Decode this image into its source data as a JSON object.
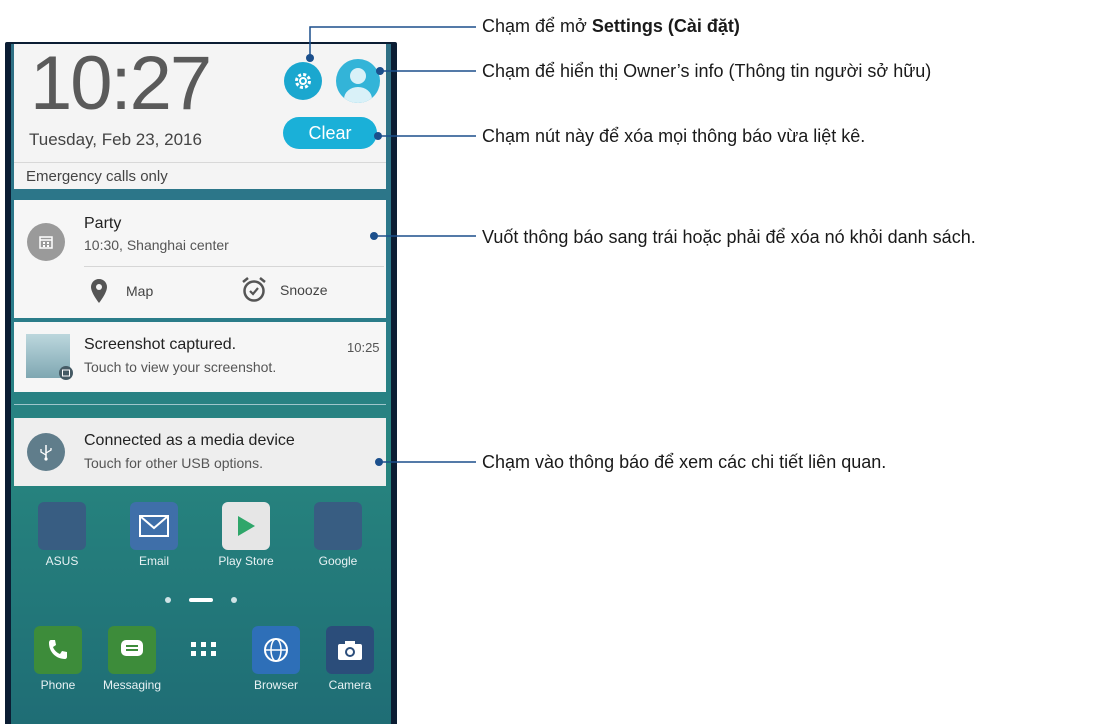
{
  "lockscreen": {
    "time": "10:27",
    "date": "Tuesday, Feb 23, 2016",
    "clear_label": "Clear",
    "emergency_text": "Emergency calls only"
  },
  "notifications": {
    "party": {
      "title": "Party",
      "subtitle": "10:30, Shanghai center",
      "action_map": "Map",
      "action_snooze": "Snooze"
    },
    "screenshot": {
      "title": "Screenshot captured.",
      "subtitle": "Touch to view your screenshot.",
      "time": "10:25"
    },
    "usb": {
      "title": "Connected as a media device",
      "subtitle": "Touch for other USB options."
    }
  },
  "home": {
    "row1": [
      "ASUS",
      "Email",
      "Play Store",
      "Google"
    ],
    "dock": [
      "Phone",
      "Messaging",
      "",
      "Browser",
      "Camera"
    ]
  },
  "callouts": {
    "settings_prefix": "Chạm để mở ",
    "settings_bold": "Settings (Cài đặt)",
    "owner": "Chạm để hiển thị Owner’s info (Thông tin người sở hữu)",
    "clear": "Chạm nút này để xóa mọi thông báo vừa liệt kê.",
    "swipe": "Vuốt thông báo sang trái hoặc phải để xóa nó khỏi danh sách.",
    "tap": "Chạm vào thông báo để xem các chi tiết liên quan."
  },
  "colors": {
    "accent": "#1aa7cf",
    "callout_line": "#1b4f8c"
  },
  "icons": [
    "gear-icon",
    "avatar-icon",
    "calendar-icon",
    "map-pin-icon",
    "alarm-icon",
    "image-icon",
    "usb-icon",
    "mail-icon",
    "play-store-icon",
    "phone-icon",
    "message-icon",
    "apps-icon",
    "globe-icon",
    "camera-icon"
  ]
}
